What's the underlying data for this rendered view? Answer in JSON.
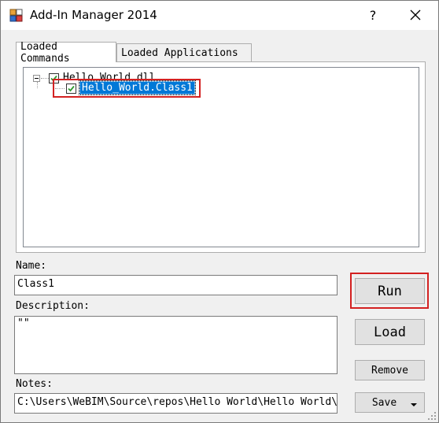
{
  "window": {
    "title": "Add-In Manager 2014",
    "help_label": "?",
    "icons": {
      "app": "app-icon",
      "close": "close-icon"
    }
  },
  "tabs": [
    {
      "label": "Loaded Commands",
      "active": true
    },
    {
      "label": "Loaded Applications",
      "active": false
    }
  ],
  "tree": {
    "root": {
      "label": "Hello_World.dll",
      "checked": true,
      "expanded": true
    },
    "child": {
      "label": "Hello_World.Class1",
      "checked": true,
      "selected": true
    }
  },
  "form": {
    "name_label": "Name:",
    "name_value": "Class1",
    "description_label": "Description:",
    "description_value": "\"\"",
    "notes_label": "Notes:",
    "notes_value": "C:\\Users\\WeBIM\\Source\\repos\\Hello World\\Hello World\\bin"
  },
  "buttons": {
    "run": "Run",
    "load": "Load",
    "remove": "Remove",
    "save": "Save"
  },
  "colors": {
    "highlight": "#d32121",
    "selection": "#0078d7",
    "check": "#2f9a2f"
  }
}
